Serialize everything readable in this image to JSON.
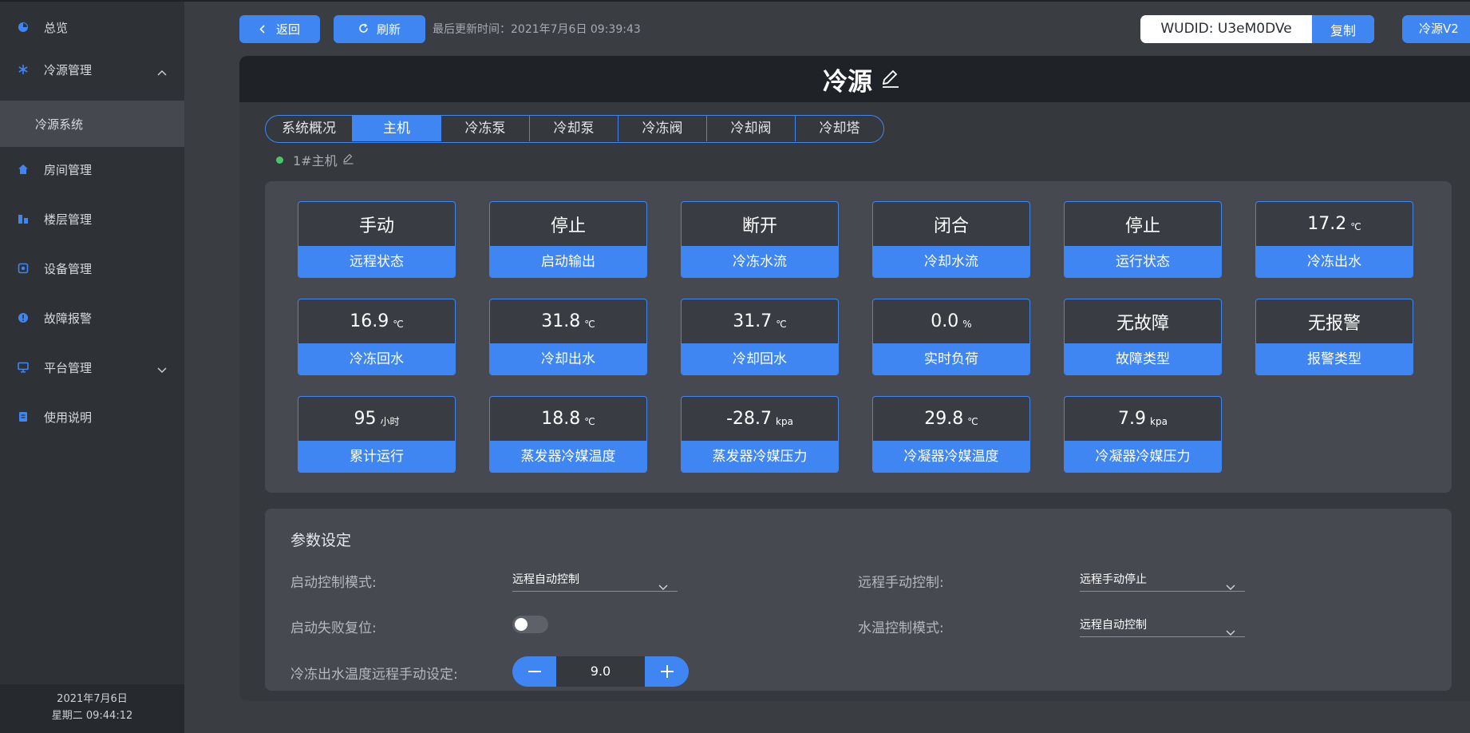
{
  "sidebar": {
    "items": [
      {
        "label": "总览",
        "icon": "dashboard-icon"
      },
      {
        "label": "冷源管理",
        "icon": "snowflake-icon",
        "expanded": true
      },
      {
        "label": "冷源系统",
        "sub": true
      },
      {
        "label": "房间管理",
        "icon": "home-icon"
      },
      {
        "label": "楼层管理",
        "icon": "building-icon"
      },
      {
        "label": "设备管理",
        "icon": "device-icon"
      },
      {
        "label": "故障报警",
        "icon": "alarm-icon"
      },
      {
        "label": "平台管理",
        "icon": "monitor-icon",
        "expanded": false
      },
      {
        "label": "使用说明",
        "icon": "doc-icon"
      }
    ],
    "footer": {
      "date": "2021年7月6日",
      "weekday_time": "星期二 09:44:12"
    }
  },
  "toolbar": {
    "back_label": "返回",
    "refresh_label": "刷新",
    "updated_text": "最后更新时间：2021年7月6日 09:39:43",
    "wudid_value": "WUDID: U3eM0DVe",
    "copy_label": "复制",
    "version_label": "冷源V2"
  },
  "page": {
    "title": "冷源",
    "tabs": [
      "系统概况",
      "主机",
      "冷冻泵",
      "冷却泵",
      "冷冻阀",
      "冷却阀",
      "冷却塔"
    ],
    "active_tab": 1,
    "unit_name": "1#主机"
  },
  "cards": [
    {
      "value": "手动",
      "unit": "",
      "label": "远程状态"
    },
    {
      "value": "停止",
      "unit": "",
      "label": "启动输出"
    },
    {
      "value": "断开",
      "unit": "",
      "label": "冷冻水流"
    },
    {
      "value": "闭合",
      "unit": "",
      "label": "冷却水流"
    },
    {
      "value": "停止",
      "unit": "",
      "label": "运行状态"
    },
    {
      "value": "17.2",
      "unit": "℃",
      "label": "冷冻出水"
    },
    {
      "value": "16.9",
      "unit": "℃",
      "label": "冷冻回水"
    },
    {
      "value": "31.8",
      "unit": "℃",
      "label": "冷却出水"
    },
    {
      "value": "31.7",
      "unit": "℃",
      "label": "冷却回水"
    },
    {
      "value": "0.0",
      "unit": "%",
      "label": "实时负荷"
    },
    {
      "value": "无故障",
      "unit": "",
      "label": "故障类型"
    },
    {
      "value": "无报警",
      "unit": "",
      "label": "报警类型"
    },
    {
      "value": "95",
      "unit": "小时",
      "label": "累计运行"
    },
    {
      "value": "18.8",
      "unit": "℃",
      "label": "蒸发器冷媒温度"
    },
    {
      "value": "-28.7",
      "unit": "kpa",
      "label": "蒸发器冷媒压力"
    },
    {
      "value": "29.8",
      "unit": "℃",
      "label": "冷凝器冷媒温度"
    },
    {
      "value": "7.9",
      "unit": "kpa",
      "label": "冷凝器冷媒压力"
    }
  ],
  "params": {
    "title": "参数设定",
    "start_mode_label": "启动控制模式:",
    "start_mode_value": "远程自动控制",
    "remote_manual_label": "远程手动控制:",
    "remote_manual_value": "远程手动停止",
    "reset_label": "启动失败复位:",
    "reset_on": false,
    "water_mode_label": "水温控制模式:",
    "water_mode_value": "远程自动控制",
    "setpoint_label": "冷冻出水温度远程手动设定:",
    "setpoint_value": "9.0"
  },
  "colors": {
    "accent": "#3f86f3",
    "sidebar": "#2e3136",
    "panel": "#35383d",
    "card_box": "#46494f",
    "status_dot": "#4bc46a"
  }
}
